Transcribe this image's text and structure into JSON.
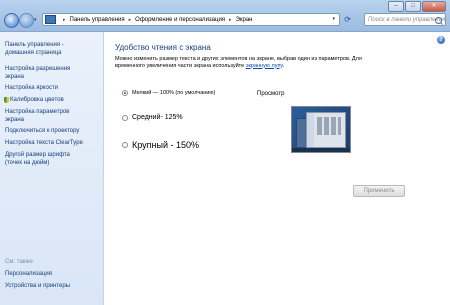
{
  "address": {
    "crumbs": [
      "Панель управления",
      "Оформление и персонализация",
      "Экран"
    ],
    "search_placeholder": "Поиск в панели управления"
  },
  "sidebar": {
    "home": [
      "Панель управления -",
      "домашняя страница"
    ],
    "items": [
      [
        "Настройка разрешения",
        "экрана"
      ],
      [
        "Настройка яркости"
      ],
      [
        "Калибровка цветов"
      ],
      [
        "Настройка параметров",
        "экрана"
      ],
      [
        "Подключиться к проектору"
      ],
      [
        "Настройка текста ClearType"
      ],
      [
        "Другой размер шрифта",
        "(точек на дюйм)"
      ]
    ],
    "see_also_title": "См. также",
    "see_also": [
      "Персонализация",
      "Устройства и принтеры"
    ]
  },
  "main": {
    "title": "Удобство чтения с экрана",
    "desc_line1": "Можно изменить размер текста и других элементов на экране, выбрав один из параметров. Для",
    "desc_line2_before": "временного увеличения части экрана используйте",
    "desc_link": "экранную лупу",
    "desc_line2_after": ".",
    "options": [
      {
        "label": "Мелкий — 100% (по умолчанию)",
        "checked": true
      },
      {
        "label": "Средний- 125%",
        "checked": false
      },
      {
        "label": "Крупный - 150%",
        "checked": false
      }
    ],
    "preview_label": "Просмотр",
    "apply_label": "Применить"
  },
  "icons": {
    "back": "back-arrow-icon",
    "forward": "forward-arrow-icon",
    "help": "help-icon",
    "search": "search-icon",
    "shield": "shield-icon"
  },
  "window_buttons": {
    "minimize": "–",
    "maximize": "□",
    "close": "✕"
  },
  "colors": {
    "accent": "#1e3f7a",
    "link": "#0645ad",
    "sidebar_bg": "#e3edf9"
  }
}
